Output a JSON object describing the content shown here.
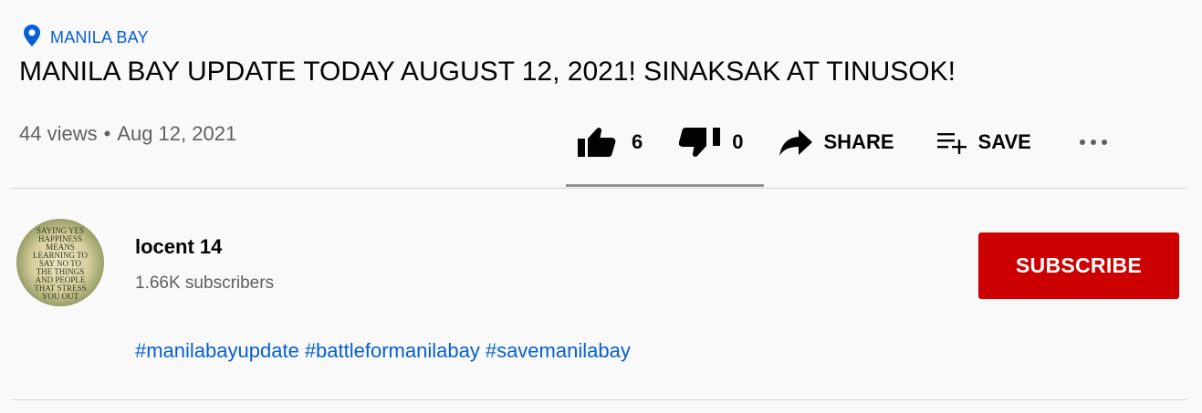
{
  "location": {
    "label": "MANILA BAY",
    "icon": "location-pin-icon"
  },
  "video": {
    "title": "MANILA BAY UPDATE TODAY AUGUST 12, 2021! SINAKSAK AT TINUSOK!",
    "views": "44 views",
    "separator": "•",
    "date": "Aug 12, 2021"
  },
  "actions": {
    "like": {
      "icon": "thumbs-up-icon",
      "count": "6"
    },
    "dislike": {
      "icon": "thumbs-down-icon",
      "count": "0"
    },
    "share": {
      "icon": "share-arrow-icon",
      "label": "SHARE"
    },
    "save": {
      "icon": "playlist-add-icon",
      "label": "SAVE"
    },
    "more": {
      "icon": "more-horizontal-icon"
    }
  },
  "channel": {
    "name": "locent 14",
    "subscribers": "1.66K subscribers",
    "subscribe_label": "SUBSCRIBE",
    "avatar_text": "SAYING YES HAPPINESS MEANS LEARNING TO SAY NO TO THE THINGS AND PEOPLE THAT STRESS YOU OUT"
  },
  "description": {
    "hashtags": [
      "#manilabayupdate",
      "#battleformanilabay",
      "#savemanilabay"
    ]
  },
  "colors": {
    "accent_link": "#065fd4",
    "subscribe_red": "#cc0000",
    "background": "#f9f9f9",
    "secondary_text": "#606060"
  }
}
